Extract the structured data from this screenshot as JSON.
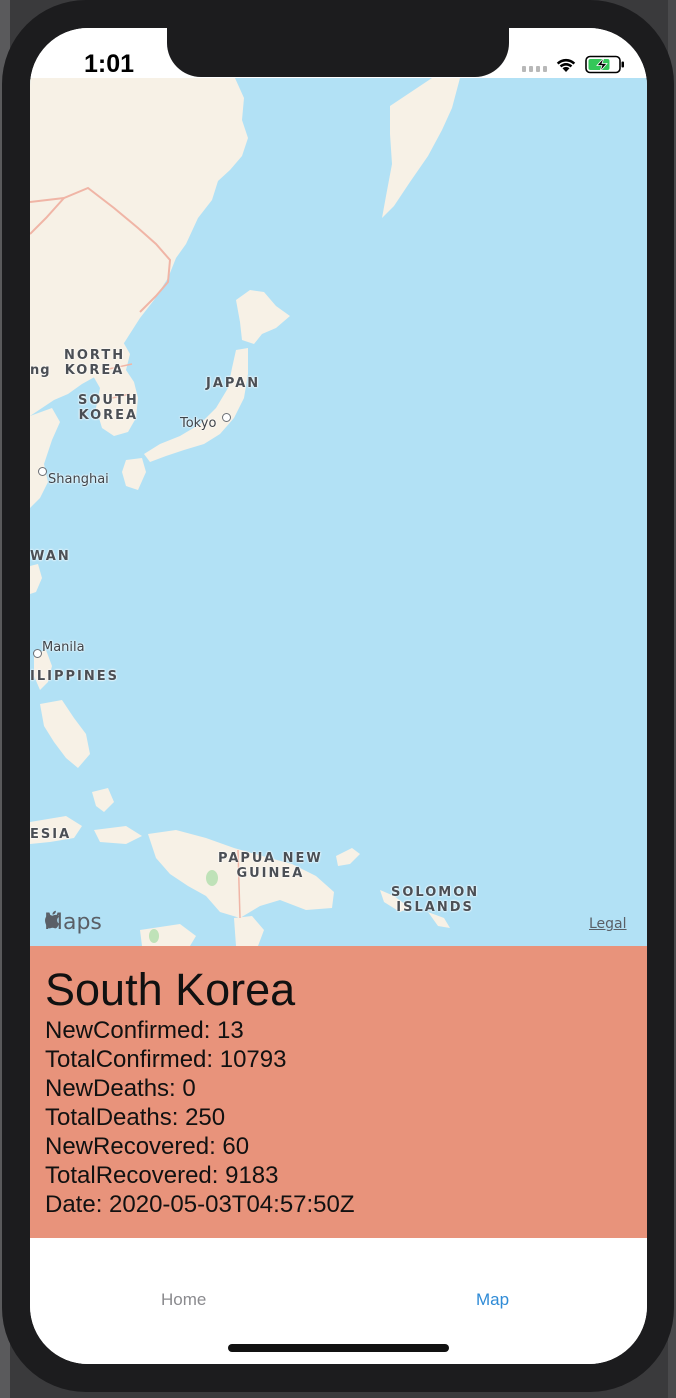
{
  "status_bar": {
    "time": "1:01"
  },
  "map": {
    "countries": [
      {
        "id": "north-korea",
        "lines": [
          "NORTH",
          "KOREA"
        ]
      },
      {
        "id": "south-korea",
        "lines": [
          "SOUTH",
          "KOREA"
        ]
      },
      {
        "id": "japan",
        "lines": [
          "JAPAN"
        ]
      },
      {
        "id": "taiwan",
        "lines": [
          "WAN"
        ]
      },
      {
        "id": "philippines",
        "lines": [
          "ILIPPINES"
        ]
      },
      {
        "id": "indonesia",
        "lines": [
          "ESIA"
        ]
      },
      {
        "id": "papua-new-guinea",
        "lines": [
          "PAPUA NEW",
          "GUINEA"
        ]
      },
      {
        "id": "solomon-islands",
        "lines": [
          "SOLOMON",
          "ISLANDS"
        ]
      },
      {
        "id": "edge-partial",
        "lines": [
          "ng"
        ]
      }
    ],
    "cities": [
      "Tokyo",
      "Shanghai",
      "Manila"
    ],
    "attribution": "Maps",
    "legal": "Legal"
  },
  "info": {
    "country": "South Korea",
    "stats": [
      "NewConfirmed: 13",
      "TotalConfirmed: 10793",
      "NewDeaths: 0",
      "TotalDeaths: 250",
      "NewRecovered: 60",
      "TotalRecovered: 9183",
      "Date: 2020-05-03T04:57:50Z"
    ]
  },
  "tabs": [
    {
      "label": "Home",
      "active": false
    },
    {
      "label": "Map",
      "active": true
    }
  ],
  "colors": {
    "ocean": "#b2e1f5",
    "land": "#f7f1e6",
    "border": "#f0b5a6",
    "info_panel": "#e8937b",
    "tab_active": "#2f8bd6",
    "tab_inactive": "#8a8a8e"
  }
}
